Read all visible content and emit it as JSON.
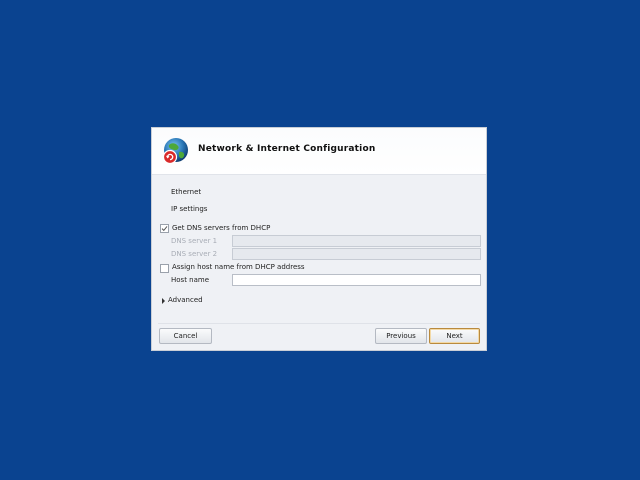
{
  "dialog": {
    "title": "Network & Internet Configuration",
    "icon": "network-globe-icon"
  },
  "sections": {
    "ethernet_label": "Ethernet",
    "ip_settings_label": "IP settings"
  },
  "dns": {
    "get_from_dhcp_label": "Get DNS servers from DHCP",
    "get_from_dhcp_checked": true,
    "server1_label": "DNS server 1",
    "server1_value": "",
    "server2_label": "DNS server 2",
    "server2_value": ""
  },
  "hostname": {
    "assign_from_dhcp_label": "Assign host name from DHCP address",
    "assign_from_dhcp_checked": false,
    "host_name_label": "Host name",
    "host_name_value": ""
  },
  "advanced_label": "Advanced",
  "buttons": {
    "cancel": "Cancel",
    "previous": "Previous",
    "next": "Next"
  },
  "colors": {
    "desktop_background": "#0a4390",
    "dialog_background": "#eff1f5",
    "default_button_border": "#b98a3e"
  }
}
